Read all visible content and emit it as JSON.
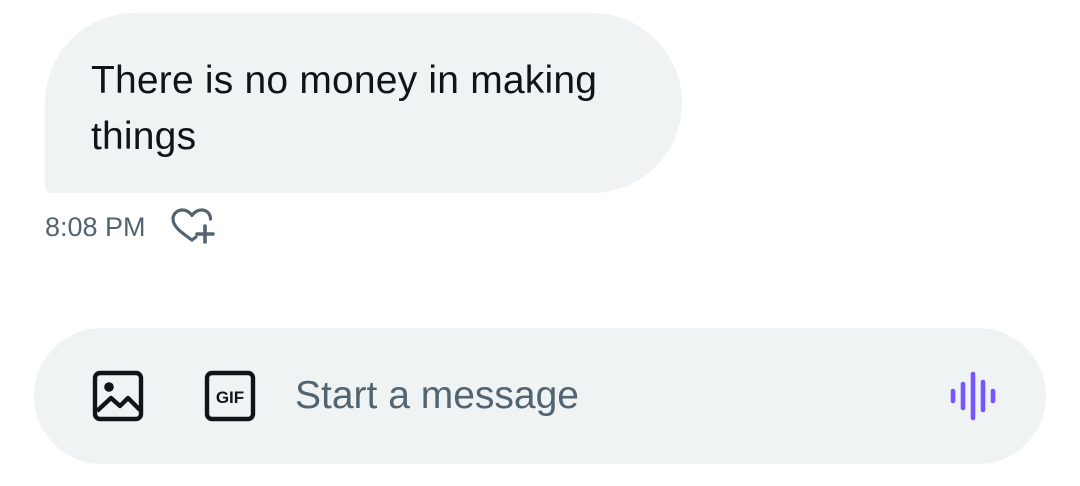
{
  "message": {
    "text": "There is no money in making things",
    "time": "8:08 PM",
    "reaction_icon": "heart-plus-icon"
  },
  "composer": {
    "placeholder": "Start a message",
    "value": "",
    "image_icon": "image-icon",
    "gif_icon": "gif-icon",
    "gif_label": "GIF",
    "voice_icon": "voice-waveform-icon"
  },
  "colors": {
    "bubble_bg": "#eff3f4",
    "text": "#0f1419",
    "muted": "#536471",
    "icon": "#0f1419",
    "accent_voice": "#7856ff"
  }
}
